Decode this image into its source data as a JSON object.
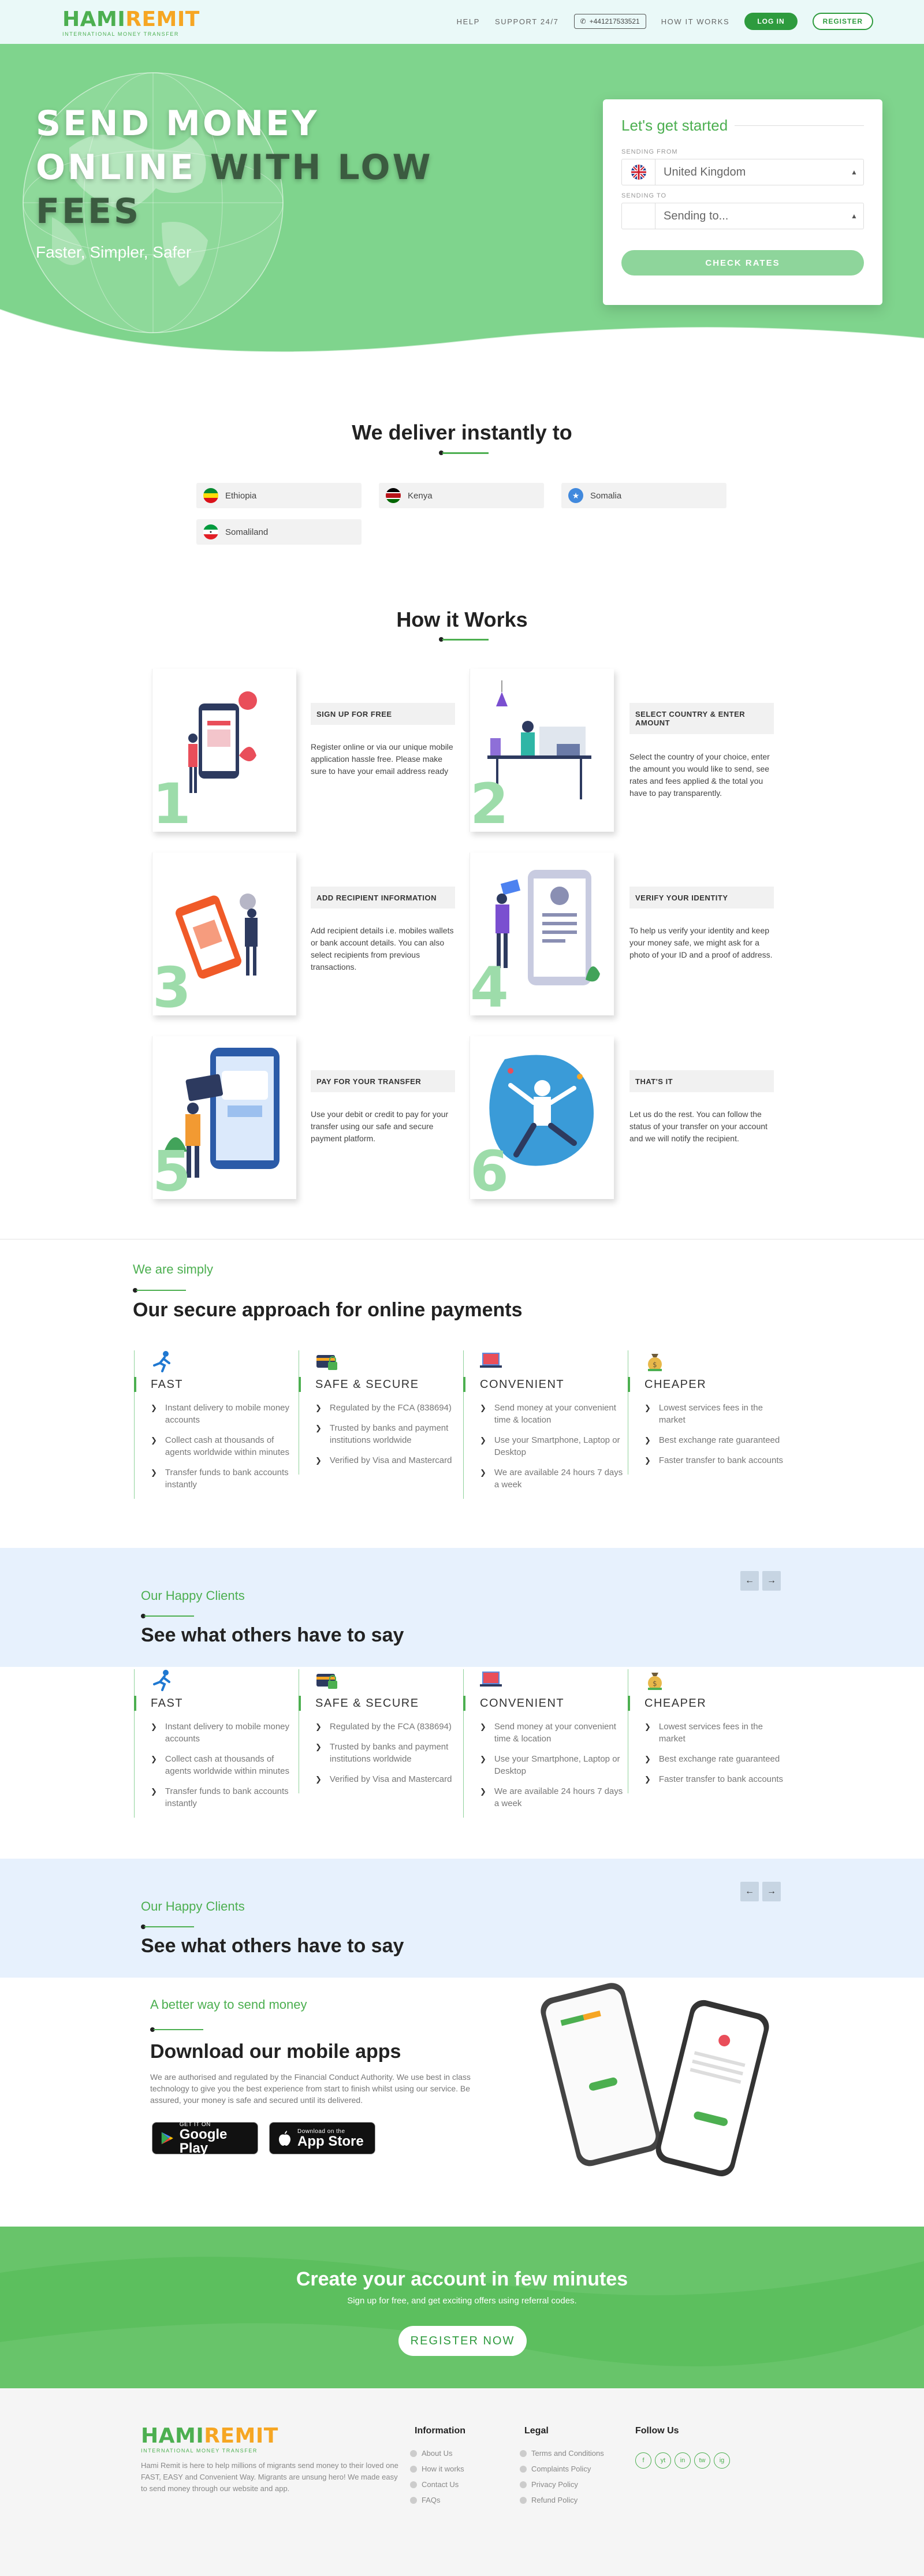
{
  "brand": {
    "name_part1": "HAMI",
    "name_part2": "REMIT",
    "tagline": "INTERNATIONAL MONEY TRANSFER"
  },
  "nav": {
    "help": "HELP",
    "support": "SUPPORT 24/7",
    "phone": "+441217533521",
    "how_it_works": "HOW IT WORKS",
    "login": "LOG IN",
    "register": "REGISTER"
  },
  "hero": {
    "title_line1": "SEND MONEY",
    "title_line2_white": "ONLINE",
    "title_line2_dark": " WITH LOW",
    "title_line3": "FEES",
    "subtitle": "Faster, Simpler, Safer"
  },
  "form": {
    "title": "Let's get started",
    "sending_from_label": "SENDING FROM",
    "sending_from_value": "United Kingdom",
    "sending_to_label": "SENDING TO",
    "sending_to_placeholder": "Sending to...",
    "submit": "CHECK RATES"
  },
  "deliver": {
    "title": "We deliver instantly to",
    "countries": [
      "Ethiopia",
      "Kenya",
      "Somalia",
      "Somaliland"
    ]
  },
  "how": {
    "title": "How it Works",
    "steps": [
      {
        "num": "1",
        "title": "SIGN UP FOR FREE",
        "desc": "Register online or via our unique mobile application hassle free. Please make sure to have your email address ready"
      },
      {
        "num": "2",
        "title": "SELECT COUNTRY & ENTER AMOUNT",
        "desc": "Select the country of your choice, enter the amount you would like to send, see rates and fees applied & the total you have to pay transparently."
      },
      {
        "num": "3",
        "title": "ADD RECIPIENT INFORMATION",
        "desc": "Add recipient details i.e. mobiles wallets or bank account details. You can also select recipients from previous transactions."
      },
      {
        "num": "4",
        "title": "VERIFY YOUR IDENTITY",
        "desc": "To help us verify your identity and keep your money safe, we might ask for a photo of your ID and a proof of address."
      },
      {
        "num": "5",
        "title": "PAY FOR YOUR TRANSFER",
        "desc": "Use your debit or credit to pay for your transfer using our safe and secure payment platform."
      },
      {
        "num": "6",
        "title": "THAT'S IT",
        "desc": "Let us do the rest. You can follow the status of your transfer on your account and we will notify the recipient."
      }
    ]
  },
  "approach": {
    "subtitle": "We are simply",
    "title": "Our secure approach for online payments"
  },
  "features_a": [
    {
      "title": "FAST",
      "icon": "runner-icon",
      "items": [
        "Instant delivery to mobile money accounts",
        "Collect cash at thousands of agents worldwide within minutes",
        "Transfer funds to bank accounts instantly"
      ]
    },
    {
      "title": "SAFE & SECURE",
      "icon": "secure-card-icon",
      "items": [
        "Regulated by the FCA (838694)",
        "Trusted by banks and payment institutions worldwide",
        "Verified by Visa and Mastercard"
      ]
    },
    {
      "title": "CONVENIENT",
      "icon": "laptop-icon",
      "items": [
        "Send money at your convenient time & location",
        "Use your Smartphone, Laptop or Desktop",
        "We are available 24 hours 7 days a week"
      ]
    },
    {
      "title": "CHEAPER",
      "icon": "money-bag-icon",
      "items": [
        "Lowest services fees in the market",
        "Best exchange rate guaranteed",
        "Faster transfer to bank accounts"
      ]
    }
  ],
  "features_b": [
    {
      "title": "FAST",
      "icon": "runner-icon",
      "items": [
        "Instant delivery to mobile money accounts",
        "Collect cash at thousands of agents worldwide within minutes",
        "Transfer funds to bank accounts instantly"
      ]
    },
    {
      "title": "SAFE & SECURE",
      "icon": "secure-card-icon",
      "items": [
        "Regulated by the FCA (838694)",
        "Trusted by banks and payment institutions worldwide",
        "Verified by Visa and Mastercard"
      ]
    },
    {
      "title": "CONVENIENT",
      "icon": "laptop-icon",
      "items": [
        "Send money at your convenient time & location",
        "Use your Smartphone, Laptop or Desktop",
        "We are available 24 hours 7 days a week"
      ]
    },
    {
      "title": "CHEAPER",
      "icon": "money-bag-icon",
      "items": [
        "Lowest services fees in the market",
        "Best exchange rate guaranteed",
        "Faster transfer to bank accounts"
      ]
    }
  ],
  "testimonials": {
    "subtitle": "Our Happy Clients",
    "title": "See what others have to say"
  },
  "app": {
    "subtitle": "A better way to send money",
    "title": "Download our mobile apps",
    "text": "We are authorised and regulated by the Financial Conduct Authority. We use best in class technology to give you the best experience from start to finish whilst using our service. Be assured, your money is safe and secured until its delivered.",
    "google_small": "GET IT ON",
    "google_big": "Google Play",
    "apple_small": "Download on the",
    "apple_big": "App Store"
  },
  "cta": {
    "title": "Create your account in few minutes",
    "subtitle": "Sign up for free, and get exciting offers using referral codes.",
    "button": "REGISTER NOW"
  },
  "footer": {
    "about": "Hami Remit is here to help millions of migrants send money to their loved one FAST, EASY and Convenient Way. Migrants are unsung hero! We made easy to send money through our website and app.",
    "information_title": "Information",
    "information_links": [
      "About Us",
      "How it works",
      "Contact Us",
      "FAQs"
    ],
    "legal_title": "Legal",
    "legal_links": [
      "Terms and Conditions",
      "Complaints Policy",
      "Privacy Policy",
      "Refund Policy"
    ],
    "follow_title": "Follow Us",
    "social": [
      "f",
      "yt",
      "in",
      "tw",
      "ig"
    ]
  },
  "colors": {
    "primary_green": "#4caf50",
    "hero_green": "#7fd48d",
    "accent_orange": "#f6a623",
    "band_blue": "#e7f1fd"
  }
}
